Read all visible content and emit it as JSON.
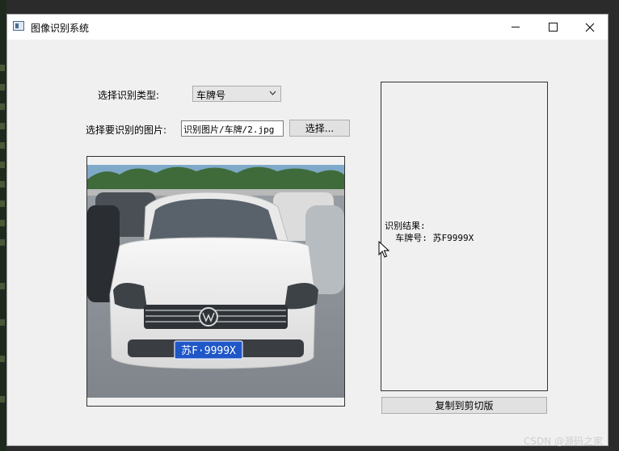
{
  "window": {
    "title": "图像识别系统"
  },
  "form": {
    "type_label": "选择识别类型:",
    "type_selected": "车牌号",
    "image_label": "选择要识别的图片:",
    "image_path": "识别图片/车牌/2.jpg",
    "choose_button": "选择..."
  },
  "preview": {
    "plate_text": "苏F·9999X"
  },
  "result": {
    "heading": "识别结果:",
    "line": "车牌号: 苏F9999X"
  },
  "actions": {
    "copy_button": "复制到剪切版"
  },
  "footer": {
    "watermark": "CSDN @源码之家"
  },
  "icons": {
    "app": "app-window-icon",
    "minimize": "minimize-icon",
    "maximize": "maximize-icon",
    "close": "close-icon",
    "dropdown": "chevron-down-icon",
    "cursor": "mouse-pointer-icon"
  },
  "colors": {
    "window_bg": "#f0f0f0",
    "plate_blue": "#1f57c8"
  }
}
